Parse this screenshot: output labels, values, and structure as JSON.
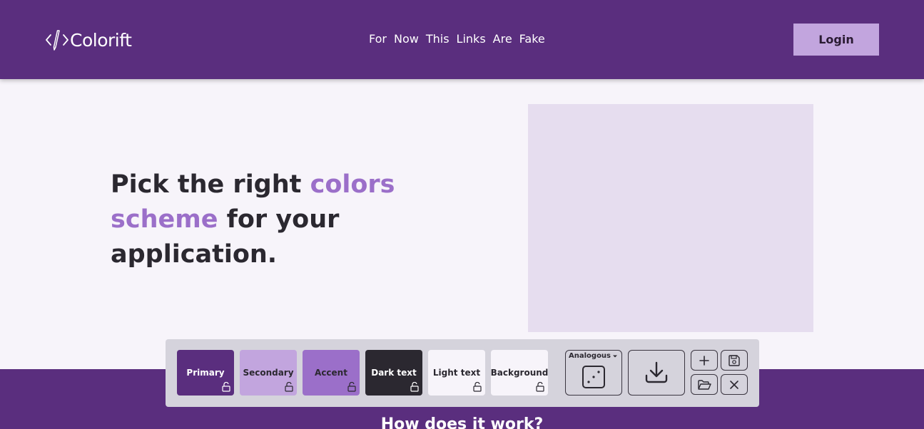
{
  "header": {
    "logo_text": "Colorift",
    "nav": [
      "For",
      "Now",
      "This",
      "Links",
      "Are",
      "Fake"
    ],
    "login_label": "Login"
  },
  "hero": {
    "title_part1": "Pick the right ",
    "title_accent1": "colors",
    "title_accent2": "scheme",
    "title_part2": " for your application."
  },
  "section": {
    "how_title": "How does it work?"
  },
  "toolbar": {
    "swatches": [
      {
        "label": "Primary",
        "color": "#5a2e7e",
        "text_color": "#ffffff"
      },
      {
        "label": "Secondary",
        "color": "#c2a5de",
        "text_color": "#2b2830"
      },
      {
        "label": "Accent",
        "color": "#9b6fc9",
        "text_color": "#2b2830"
      },
      {
        "label": "Dark text",
        "color": "#2b2830",
        "text_color": "#ffffff"
      },
      {
        "label": "Light text",
        "color": "#f7f4fa",
        "text_color": "#2b2830"
      },
      {
        "label": "Background",
        "color": "#f7f4fa",
        "text_color": "#2b2830"
      }
    ],
    "scheme_label": "Analogous",
    "icons": {
      "dice": "dice-icon",
      "download": "download-icon",
      "add": "plus-icon",
      "save": "save-icon",
      "open": "folder-open-icon",
      "close": "close-icon"
    }
  },
  "colors": {
    "brand": "#5a2e7e",
    "accent": "#9b6fc9",
    "hero_image": "#e6ddef"
  }
}
